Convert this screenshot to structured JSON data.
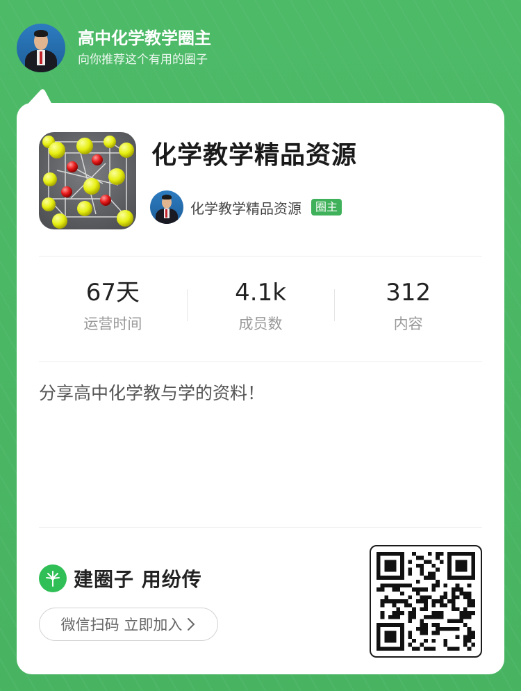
{
  "header": {
    "title": "高中化学教学圈主",
    "subtitle": "向你推荐这个有用的圈子"
  },
  "group": {
    "name": "化学教学精品资源",
    "owner_name": "化学教学精品资源",
    "owner_badge": "圈主"
  },
  "stats": [
    {
      "value": "67天",
      "label": "运营时间"
    },
    {
      "value": "4.1k",
      "label": "成员数"
    },
    {
      "value": "312",
      "label": "内容"
    }
  ],
  "description": "分享高中化学教与学的资料！",
  "footer": {
    "brand_text": "建圈子 用纷传",
    "join_label": "微信扫码 立即加入",
    "join_icon": "chevron-right-icon"
  },
  "colors": {
    "background": "#4cb866",
    "accent": "#3fb15a",
    "brand": "#2fbf56"
  }
}
